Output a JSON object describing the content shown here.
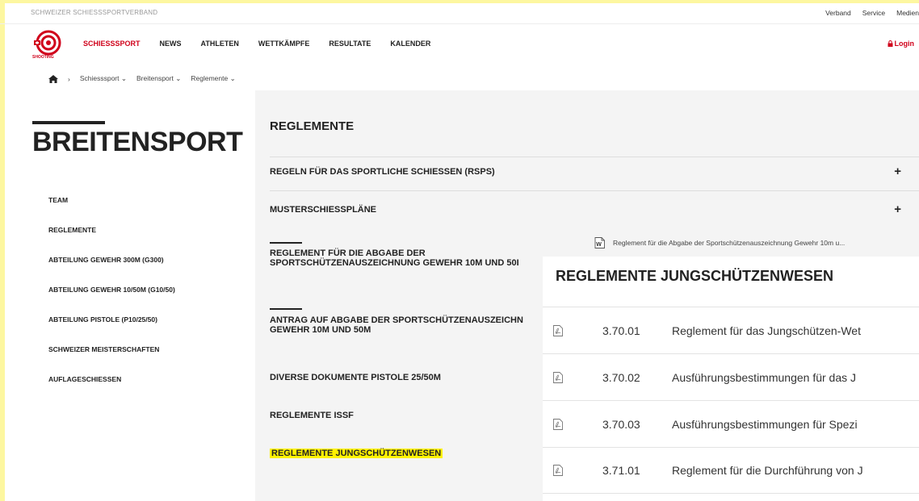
{
  "topbar": {
    "org": "SCHWEIZER SCHIESSSPORTVERBAND",
    "links": [
      "Verband",
      "Service",
      "Medien"
    ]
  },
  "nav": {
    "logo_text": "SHOOTING",
    "items": [
      "SCHIESSSPORT",
      "NEWS",
      "ATHLETEN",
      "WETTKÄMPFE",
      "RESULTATE",
      "KALENDER"
    ],
    "login": "Login"
  },
  "breadcrumb": [
    "Schiesssport",
    "Breitensport",
    "Reglemente"
  ],
  "page_title": "BREITENSPORT",
  "sidenav": [
    "TEAM",
    "REGLEMENTE",
    "ABTEILUNG GEWEHR 300M (G300)",
    "ABTEILUNG GEWEHR 10/50M (G10/50)",
    "ABTEILUNG PISTOLE (P10/25/50)",
    "SCHWEIZER MEISTERSCHAFTEN",
    "AUFLAGESCHIESSEN"
  ],
  "main": {
    "section_title": "REGLEMENTE",
    "accordion": [
      "REGELN FÜR DAS SPORTLICHE SCHIESSEN (RSPS)",
      "MUSTERSCHIESSPLÄNE",
      "REGLEMENT FÜR DIE ABGABE DER",
      "SPORTSCHÜTZENAUSZEICHNUNG GEWEHR 10M UND 50I",
      "ANTRAG AUF ABGABE DER SPORTSCHÜTZENAUSZEICHN",
      "GEWEHR 10M UND 50M",
      "DIVERSE DOKUMENTE PISTOLE 25/50M",
      "REGLEMENTE ISSF",
      "REGLEMENTE JUNGSCHÜTZENWESEN"
    ],
    "plus": "+",
    "doc_link": "Reglement für die Abgabe der Sportschützenauszeichnung Gewehr 10m u..."
  },
  "overlay": {
    "title": "REGLEMENTE JUNGSCHÜTZENWESEN",
    "rows": [
      {
        "num": "3.70.01",
        "desc": "Reglement für das Jungschützen-Wet"
      },
      {
        "num": "3.70.02",
        "desc": "Ausführungsbestimmungen für das J"
      },
      {
        "num": "3.70.03",
        "desc": "Ausführungsbestimmungen für Spezi"
      },
      {
        "num": "3.71.01",
        "desc": "Reglement für die Durchführung von J"
      }
    ]
  },
  "colors": {
    "accent": "#d0021b",
    "highlight": "#fff200",
    "panel": "#f4f4f4"
  }
}
